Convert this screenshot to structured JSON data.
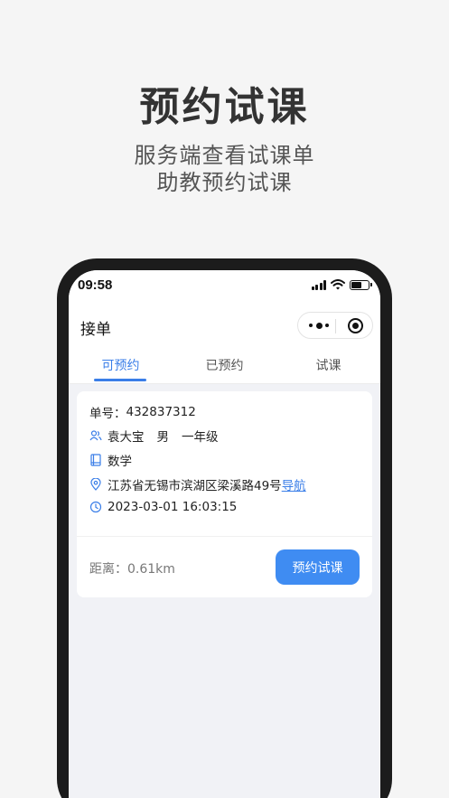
{
  "promo": {
    "title": "预约试课",
    "subtitle_line1": "服务端查看试课单",
    "subtitle_line2": "助教预约试课"
  },
  "status_bar": {
    "time": "09:58",
    "battery_level": 0.6
  },
  "navbar": {
    "title": "接单"
  },
  "tabs": [
    {
      "label": "可预约",
      "active": true
    },
    {
      "label": "已预约",
      "active": false
    },
    {
      "label": "试课",
      "active": false
    }
  ],
  "order": {
    "order_no_label": "单号：",
    "order_no": "432837312",
    "student_name": "袁大宝",
    "student_gender": "男",
    "student_grade": "一年级",
    "subject": "数学",
    "address": "江苏省无锡市滨湖区梁溪路49号",
    "nav_label": "导航",
    "datetime": "2023-03-01 16:03:15",
    "distance": "距离：0.61km",
    "book_button": "预约试课"
  },
  "icons": {
    "student": "people-icon",
    "subject": "book-icon",
    "address": "location-pin-icon",
    "time": "clock-icon"
  },
  "colors": {
    "accent": "#3a7ee8",
    "button": "#3f8cf2",
    "page_bg": "#f1f2f6"
  }
}
